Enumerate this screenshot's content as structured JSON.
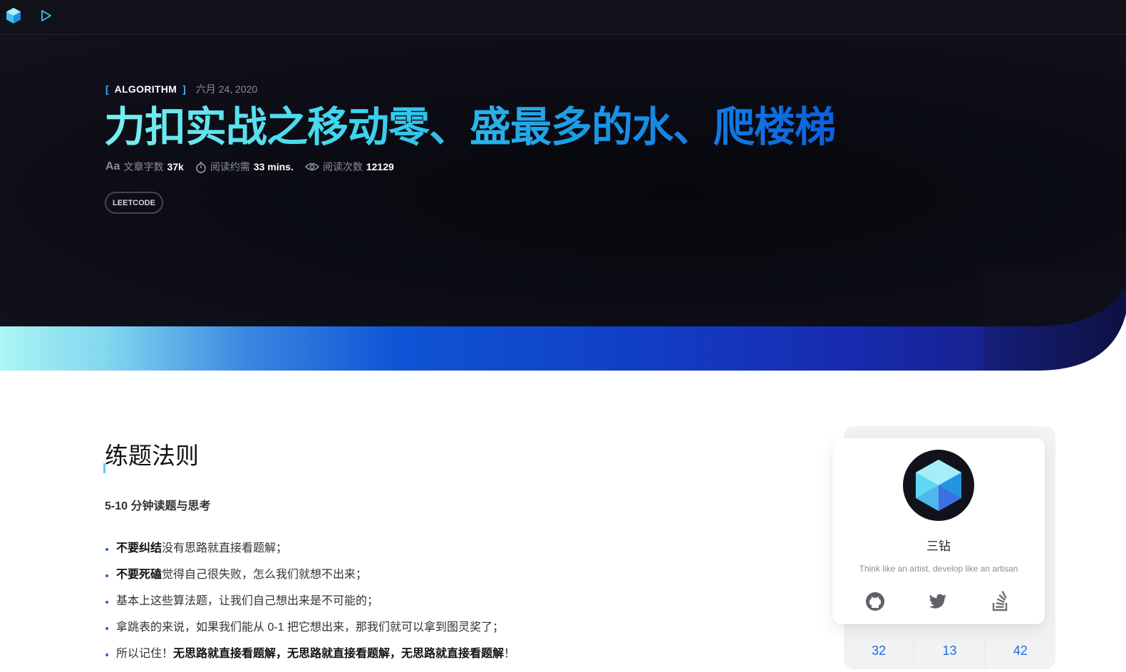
{
  "post": {
    "category": "ALGORITHM",
    "date": "六月 24, 2020",
    "title": "力扣实战之移动零、盛最多的水、爬楼梯",
    "stats": {
      "words_label": "文章字数",
      "words_value": "37k",
      "read_time_label": "阅读约需",
      "read_time_value": "33 mins.",
      "views_label": "阅读次数",
      "views_value": "12129"
    },
    "tag": "LEETCODE"
  },
  "article": {
    "heading": "练题法则",
    "subheading": "5-10 分钟读题与思考",
    "items": [
      {
        "bold": "不要纠结",
        "text": "没有思路就直接看题解；"
      },
      {
        "bold": "不要死磕",
        "text": "觉得自己很失败，怎么我们就想不出来；"
      },
      {
        "bold": "",
        "text": "基本上这些算法题，让我们自己想出来是不可能的；"
      },
      {
        "bold": "",
        "text": "拿跳表的来说，如果我们能从 0-1 把它想出来，那我们就可以拿到图灵奖了；"
      },
      {
        "prefix": "所以记住！",
        "bold": "无思路就直接看题解，无思路就直接看题解，无思路就直接看题解",
        "suffix": "！"
      }
    ]
  },
  "profile": {
    "name": "三钻",
    "motto": "Think like an artist, develop like an artisan",
    "social": [
      "github-icon",
      "twitter-icon",
      "stackoverflow-icon"
    ],
    "counts": [
      "32",
      "13",
      "42"
    ]
  },
  "colors": {
    "accent": "#35b4ff",
    "title_gradient_start": "#7af0ef",
    "title_gradient_end": "#0b5fe0",
    "count_color": "#1f6cde"
  }
}
